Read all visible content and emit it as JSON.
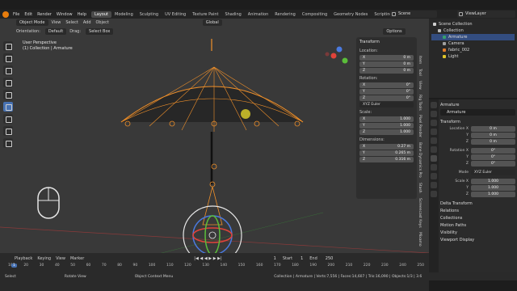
{
  "menu": [
    "File",
    "Edit",
    "Render",
    "Window",
    "Help"
  ],
  "workspaces": [
    "Layout",
    "Modeling",
    "Sculpting",
    "UV Editing",
    "Texture Paint",
    "Shading",
    "Animation",
    "Rendering",
    "Compositing",
    "Geometry Nodes",
    "Scripting"
  ],
  "scene": "Scene",
  "view_layer": "ViewLayer",
  "viewport": {
    "mode": "Object Mode",
    "menus": [
      "View",
      "Select",
      "Add",
      "Object"
    ],
    "orientation_label": "Orientation:",
    "orientation_value": "Default",
    "drag_label": "Drag:",
    "drag_value": "Select Box",
    "transform_global": "Global",
    "options": "Options",
    "info_line1": "User Perspective",
    "info_line2": "(1) Collection | Armature"
  },
  "npanel": {
    "title": "Transform",
    "location_label": "Location:",
    "location": [
      {
        "axis": "X",
        "value": "0 m"
      },
      {
        "axis": "Y",
        "value": "0 m"
      },
      {
        "axis": "Z",
        "value": "0 m"
      }
    ],
    "rotation_label": "Rotation:",
    "rotation": [
      {
        "axis": "X",
        "value": "0°"
      },
      {
        "axis": "Y",
        "value": "0°"
      },
      {
        "axis": "Z",
        "value": "0°"
      }
    ],
    "rotation_mode": "XYZ Euler",
    "scale_label": "Scale:",
    "scale": [
      {
        "axis": "X",
        "value": "1.000"
      },
      {
        "axis": "Y",
        "value": "1.000"
      },
      {
        "axis": "Z",
        "value": "1.000"
      }
    ],
    "dimensions_label": "Dimensions:",
    "dimensions": [
      {
        "axis": "X",
        "value": "0.27 m"
      },
      {
        "axis": "Y",
        "value": "0.265 m"
      },
      {
        "axis": "Z",
        "value": "0.316 m"
      }
    ],
    "tabs": [
      "Item",
      "Tool",
      "View",
      "Rig Tools",
      "Pixel Render",
      "Bone Dynamics Pro",
      "Stash",
      "Screencast Keys",
      "Mixamo"
    ]
  },
  "outliner": {
    "title": "Scene Collection",
    "items": [
      {
        "name": "Collection",
        "color": "#bbbbbb"
      },
      {
        "name": "Armature",
        "color": "#37a06e"
      },
      {
        "name": "Camera",
        "color": "#a0a0a0"
      },
      {
        "name": "fabric_002",
        "color": "#e07b2a"
      },
      {
        "name": "Light",
        "color": "#e0c52a"
      }
    ]
  },
  "properties": {
    "object_name": "Armature",
    "object_field": "Armature",
    "transform_title": "Transform",
    "location": [
      {
        "label": "Location X",
        "value": "0 m"
      },
      {
        "label": "Y",
        "value": "0 m"
      },
      {
        "label": "Z",
        "value": "0 m"
      }
    ],
    "rotation": [
      {
        "label": "Rotation X",
        "value": "0°"
      },
      {
        "label": "Y",
        "value": "0°"
      },
      {
        "label": "Z",
        "value": "0°"
      }
    ],
    "mode_label": "Mode",
    "mode_value": "XYZ Euler",
    "scale": [
      {
        "label": "Scale X",
        "value": "1.000"
      },
      {
        "label": "Y",
        "value": "1.000"
      },
      {
        "label": "Z",
        "value": "1.000"
      }
    ],
    "sections": [
      "Delta Transform",
      "Relations",
      "Collections",
      "Motion Paths",
      "Visibility",
      "Viewport Display"
    ]
  },
  "timeline": {
    "menus": [
      "Playback",
      "Keying",
      "View",
      "Marker"
    ],
    "current_frame": "1",
    "start_label": "Start",
    "start": "1",
    "end_label": "End",
    "end": "250",
    "ticks": [
      "10",
      "20",
      "30",
      "40",
      "50",
      "60",
      "70",
      "80",
      "90",
      "100",
      "110",
      "120",
      "130",
      "140",
      "150",
      "160",
      "170",
      "180",
      "190",
      "200",
      "210",
      "220",
      "230",
      "240",
      "250"
    ]
  },
  "status": {
    "select": "Select",
    "rotate": "Rotate View",
    "context": "Object Context Menu",
    "stats": "Collection | Armature | Verts:7,556 | Faces:14,607 | Tris:16,090 | Objects:1/3 | 3.6"
  },
  "colors": {
    "armature": "#f0902a",
    "accent": "#4772b3"
  }
}
